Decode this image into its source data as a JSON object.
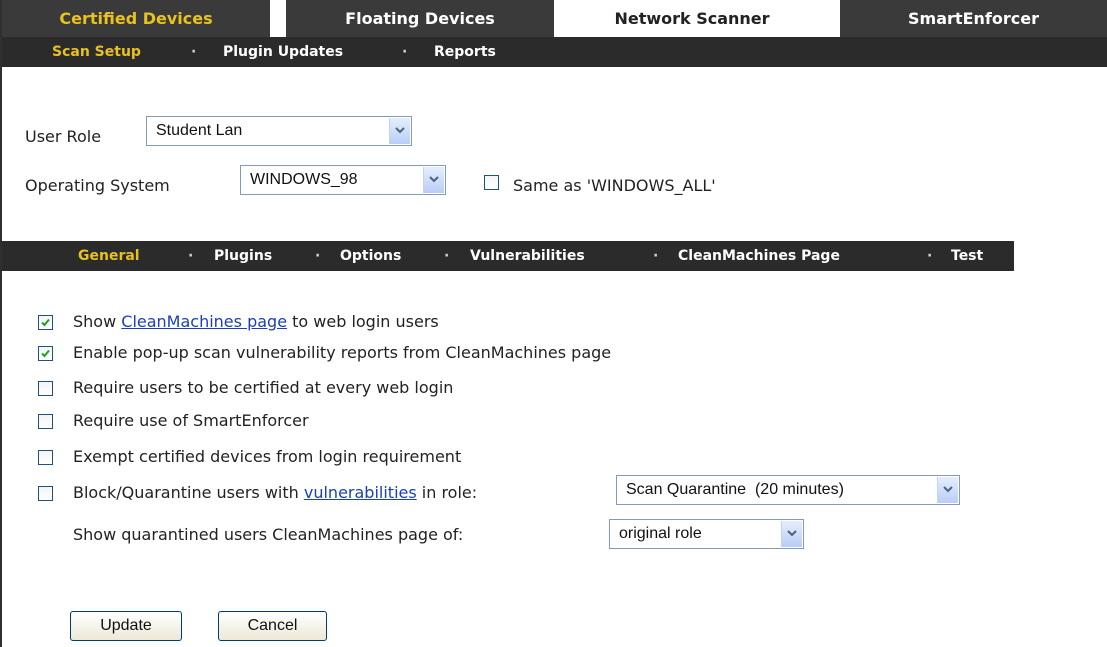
{
  "top_tabs": [
    {
      "label": "Certified Devices"
    },
    {
      "label": "Floating Devices"
    },
    {
      "label": "Network Scanner"
    },
    {
      "label": "SmartEnforcer"
    }
  ],
  "subnav": {
    "items": [
      "Scan Setup",
      "Plugin Updates",
      "Reports"
    ],
    "separator": "·"
  },
  "role": {
    "label": "User Role",
    "value": "Student Lan"
  },
  "os": {
    "label": "Operating System",
    "value": "WINDOWS_98",
    "same_as_label": "Same as 'WINDOWS_ALL'",
    "same_as_checked": false
  },
  "inner_nav": {
    "items": [
      "General",
      "Plugins",
      "Options",
      "Vulnerabilities",
      "CleanMachines Page",
      "Test"
    ],
    "separator": "·"
  },
  "options": {
    "show_cm": {
      "prefix": "Show",
      "link": "CleanMachines page",
      "suffix": " to web login users",
      "checked": true
    },
    "enable_popup": {
      "label": "Enable pop-up scan vulnerability reports from CleanMachines page",
      "checked": true
    },
    "require_cert": {
      "label": "Require users to be certified at every web login",
      "checked": false
    },
    "require_smart": {
      "label": "Require use of SmartEnforcer",
      "checked": false
    },
    "exempt": {
      "label": "Exempt certified devices from login requirement",
      "checked": false
    },
    "block": {
      "prefix": "Block/Quarantine users with",
      "link": "vulnerabilities",
      "suffix": "in role:",
      "checked": false,
      "select_value": "Scan Quarantine  (20 minutes)"
    },
    "show_quarantined": {
      "label": "Show quarantined users CleanMachines page of:",
      "select_value": "original role"
    }
  },
  "buttons": {
    "update": "Update",
    "cancel": "Cancel"
  }
}
